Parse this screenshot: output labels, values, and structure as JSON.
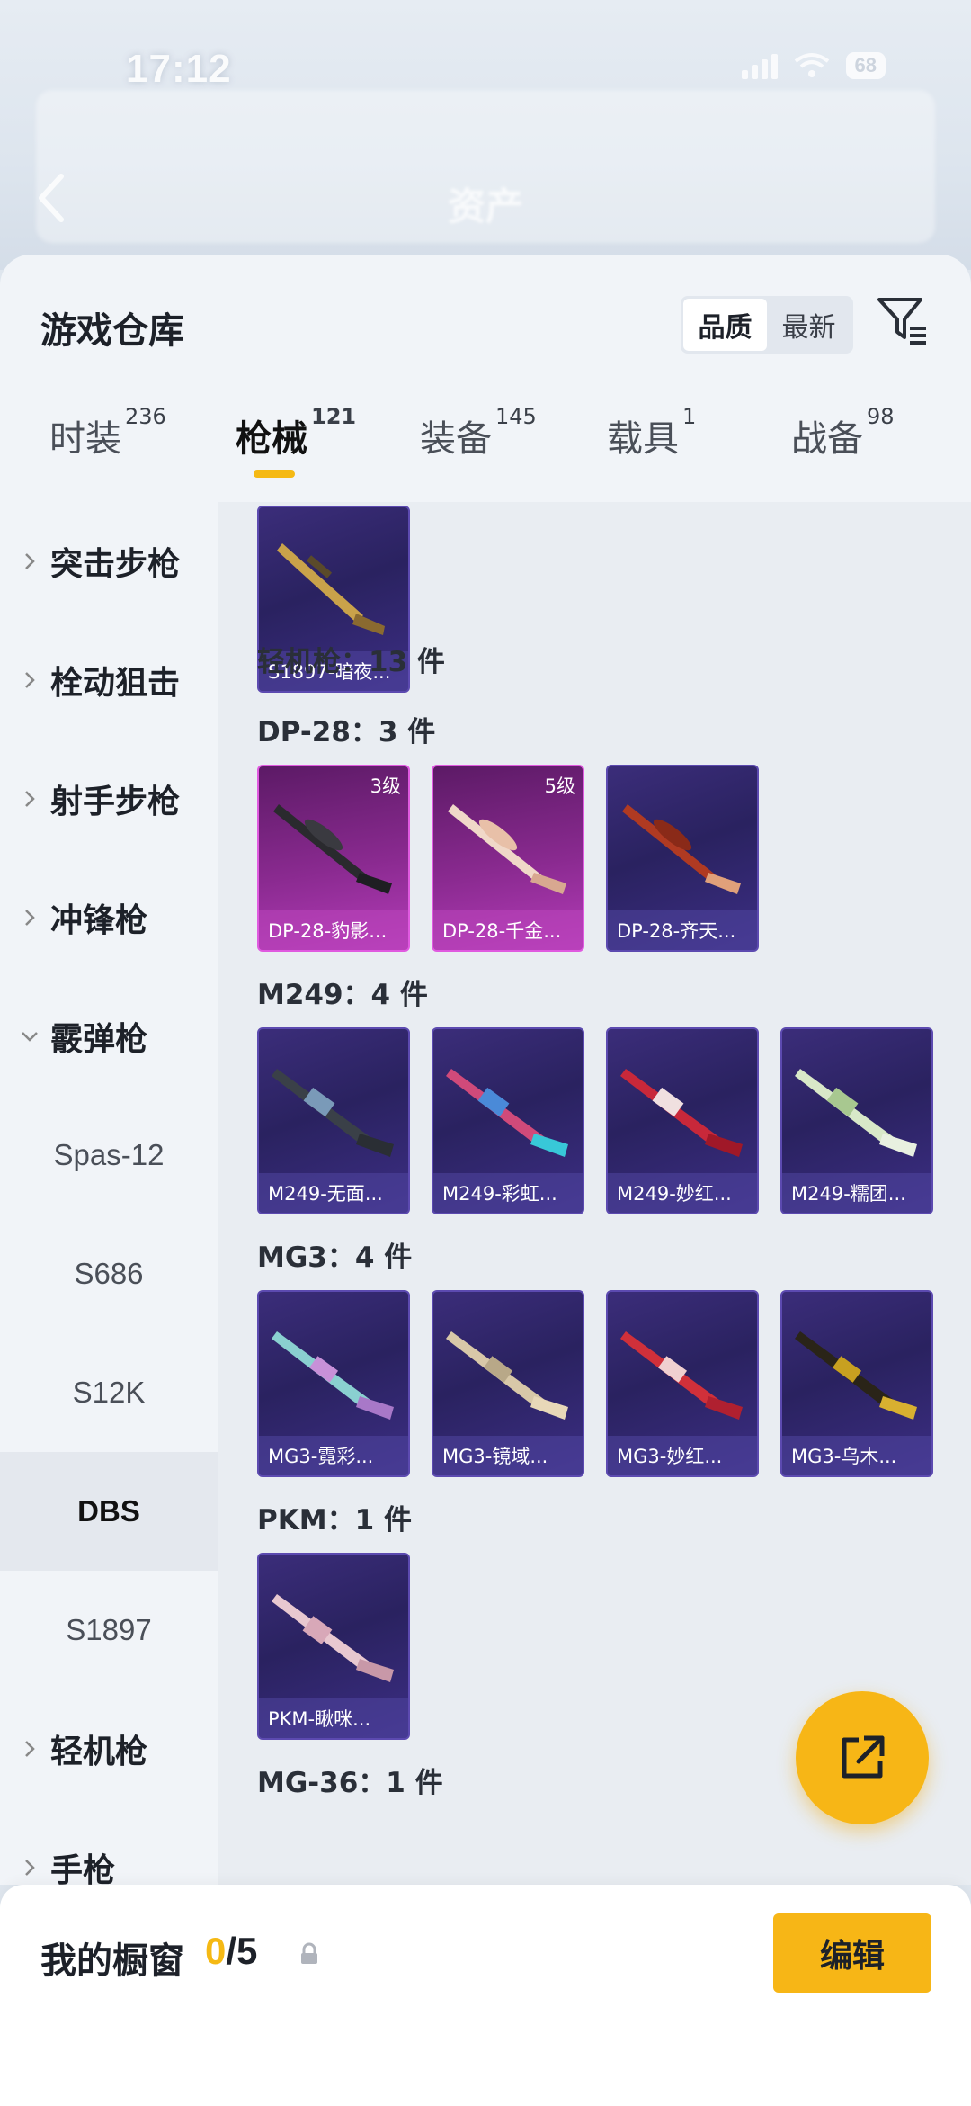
{
  "status_bar": {
    "time": "17:12",
    "battery": "68"
  },
  "header": {
    "title": "资产"
  },
  "sheet": {
    "title": "游戏仓库",
    "sort_options": [
      "品质",
      "最新"
    ],
    "sort_active": "品质"
  },
  "tabs": [
    {
      "label": "时装",
      "count": "236"
    },
    {
      "label": "枪械",
      "count": "121"
    },
    {
      "label": "装备",
      "count": "145"
    },
    {
      "label": "载具",
      "count": "1"
    },
    {
      "label": "战备",
      "count": "98"
    }
  ],
  "active_tab": "枪械",
  "categories": [
    {
      "label": "突击步枪"
    },
    {
      "label": "栓动狙击"
    },
    {
      "label": "射手步枪"
    },
    {
      "label": "冲锋枪"
    },
    {
      "label": "霰弹枪"
    },
    {
      "label": "Spas-12"
    },
    {
      "label": "S686"
    },
    {
      "label": "S12K"
    },
    {
      "label": "DBS"
    },
    {
      "label": "S1897"
    },
    {
      "label": "轻机枪"
    },
    {
      "label": "手枪"
    }
  ],
  "selected_category": "DBS",
  "content": {
    "top_card": {
      "name": "S1897-暗夜..."
    },
    "section_title": "轻机枪：13 件",
    "groups": [
      {
        "title": "DP-28：3 件",
        "items": [
          {
            "name": "DP-28-豹影...",
            "level": "3级",
            "style": "pink"
          },
          {
            "name": "DP-28-千金...",
            "level": "5级",
            "style": "pink"
          },
          {
            "name": "DP-28-齐天...",
            "level": "",
            "style": "purple"
          }
        ]
      },
      {
        "title": "M249：4 件",
        "items": [
          {
            "name": "M249-无面...",
            "level": "",
            "style": "purple"
          },
          {
            "name": "M249-彩虹...",
            "level": "",
            "style": "purple"
          },
          {
            "name": "M249-妙红...",
            "level": "",
            "style": "purple"
          },
          {
            "name": "M249-糯团...",
            "level": "",
            "style": "purple"
          }
        ]
      },
      {
        "title": "MG3：4 件",
        "items": [
          {
            "name": "MG3-霓彩...",
            "level": "",
            "style": "purple"
          },
          {
            "name": "MG3-镜域...",
            "level": "",
            "style": "purple"
          },
          {
            "name": "MG3-妙红...",
            "level": "",
            "style": "purple"
          },
          {
            "name": "MG3-乌木...",
            "level": "",
            "style": "purple"
          }
        ]
      },
      {
        "title": "PKM：1 件",
        "items": [
          {
            "name": "PKM-瞅咪...",
            "level": "",
            "style": "purple"
          }
        ]
      },
      {
        "title": "MG-36：1 件",
        "items": []
      }
    ]
  },
  "showcase": {
    "label": "我的橱窗",
    "current": "0",
    "total": "/5",
    "edit_label": "编辑"
  },
  "colors": {
    "accent": "#f7b616",
    "card_purple": "#2a2260",
    "card_pink": "#8a2a90"
  },
  "icons": {
    "back": "chevron-left-icon",
    "filter": "filter-icon",
    "share": "external-link-icon",
    "lock": "lock-icon",
    "expand": "chevron-right-icon",
    "collapse": "chevron-down-icon"
  }
}
